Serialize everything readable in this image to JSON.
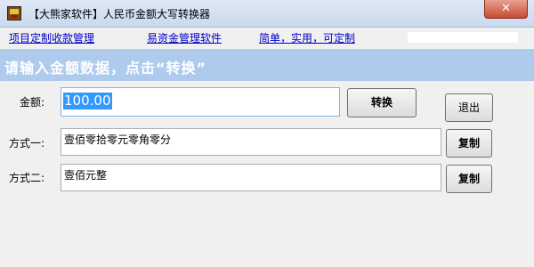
{
  "window": {
    "title": "【大熊家软件】人民币金额大写转换器",
    "close_glyph": "✕",
    "icon": "bear-app-icon"
  },
  "menu": {
    "links": [
      "项目定制收款管理",
      "易资金管理软件",
      "简单，实用，可定制"
    ]
  },
  "banner": {
    "text": "请输入金额数据，点击“转换”"
  },
  "form": {
    "amount_label": "金额:",
    "amount_value": "100.00",
    "convert_label": "转换",
    "exit_label": "退出",
    "mode1_label": "方式一:",
    "mode1_value": "壹佰零拾零元零角零分",
    "copy1_label": "复制",
    "mode2_label": "方式二:",
    "mode2_value": "壹佰元整",
    "copy2_label": "复制"
  },
  "colors": {
    "banner": "#aecbee",
    "link": "#0000c8",
    "selection": "#3399ff",
    "close": "#c84a32"
  }
}
